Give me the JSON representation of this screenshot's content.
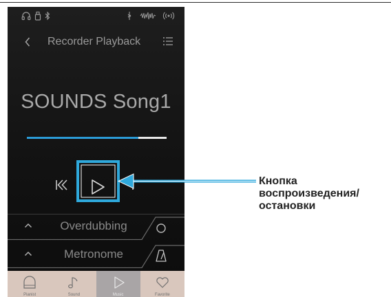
{
  "nav": {
    "title": "Recorder Playback"
  },
  "song": {
    "title": "SOUNDS Song1",
    "progress": 0.8
  },
  "panels": [
    {
      "label": "Overdubbing"
    },
    {
      "label": "Metronome"
    }
  ],
  "tabs": [
    {
      "label": "Pianist",
      "icon": "piano-icon",
      "active": false
    },
    {
      "label": "Sound",
      "icon": "music-note-icon",
      "active": false
    },
    {
      "label": "Music",
      "icon": "play-icon",
      "active": true
    },
    {
      "label": "Favorite",
      "icon": "heart-icon",
      "active": false
    }
  ],
  "callout": {
    "lines": [
      "Кнопка",
      "воспроизведения/",
      "остановки"
    ]
  },
  "colors": {
    "accent": "#2b9bd6",
    "callout": "#2fa9dc",
    "tab_bg": "#d9c7bd",
    "tab_active_bg": "#a9a5a6"
  }
}
